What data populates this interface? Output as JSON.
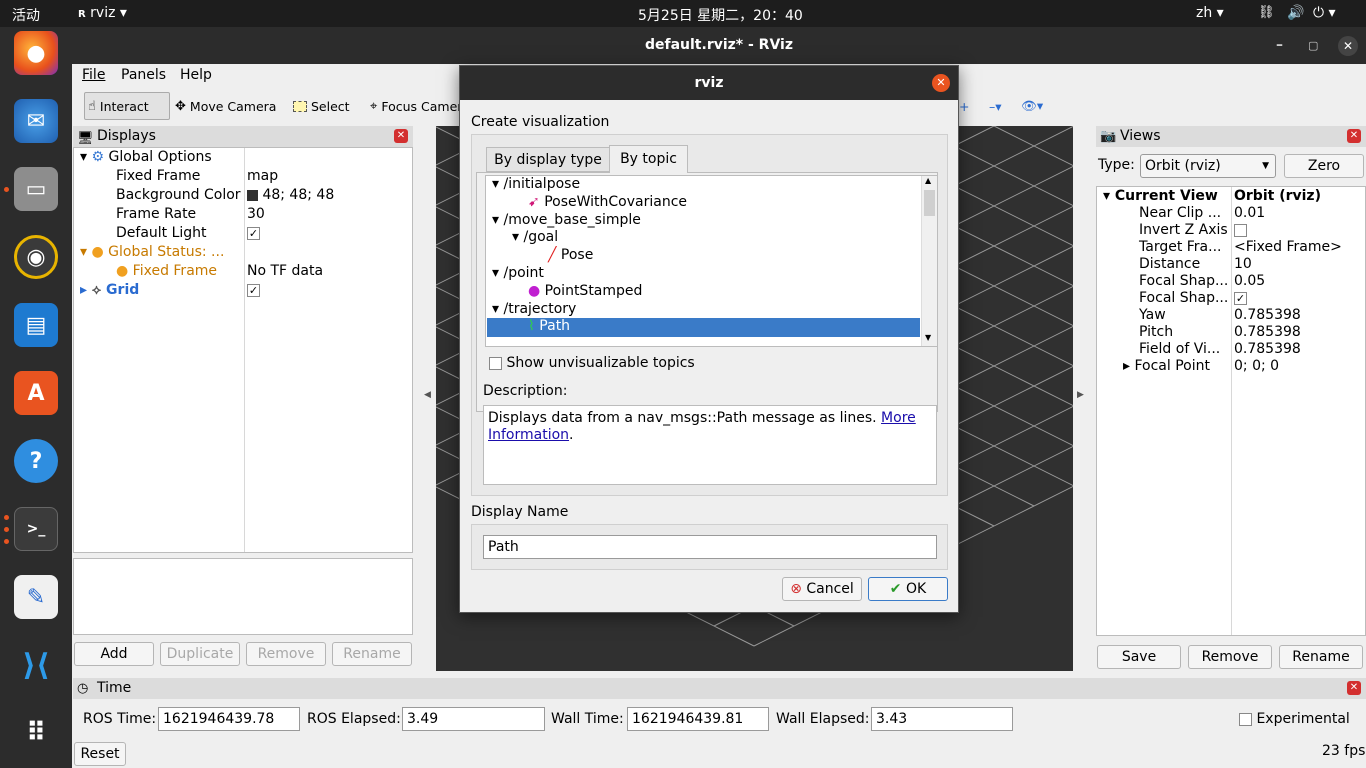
{
  "topbar": {
    "activities": "活动",
    "app": "rviz",
    "clock": "5月25日 星期二，20：40",
    "lang": "zh"
  },
  "window": {
    "title": "default.rviz* - RViz"
  },
  "menu": {
    "file": "File",
    "panels": "Panels",
    "help": "Help"
  },
  "toolbar": {
    "interact": "Interact",
    "move_camera": "Move Camera",
    "select": "Select",
    "focus_camera": "Focus Camera"
  },
  "displays": {
    "title": "Displays",
    "global_options": "Global Options",
    "fixed_frame_label": "Fixed Frame",
    "fixed_frame_value": "map",
    "bg_label": "Background Color",
    "bg_value": "48; 48; 48",
    "frame_rate_label": "Frame Rate",
    "frame_rate_value": "30",
    "default_light_label": "Default Light",
    "global_status": "Global Status: ...",
    "status_fixed_frame": "Fixed Frame",
    "status_fixed_frame_value": "No TF data",
    "grid": "Grid",
    "buttons": {
      "add": "Add",
      "duplicate": "Duplicate",
      "remove": "Remove",
      "rename": "Rename"
    }
  },
  "views": {
    "title": "Views",
    "type_label": "Type:",
    "type_value": "Orbit (rviz)",
    "zero": "Zero",
    "current_view": "Current View",
    "current_view_value": "Orbit (rviz)",
    "rows": [
      {
        "label": "Near Clip ...",
        "value": "0.01"
      },
      {
        "label": "Invert Z Axis",
        "value": ""
      },
      {
        "label": "Target Fra...",
        "value": "<Fixed Frame>"
      },
      {
        "label": "Distance",
        "value": "10"
      },
      {
        "label": "Focal Shap...",
        "value": "0.05"
      },
      {
        "label": "Focal Shap...",
        "value": ""
      },
      {
        "label": "Yaw",
        "value": "0.785398"
      },
      {
        "label": "Pitch",
        "value": "0.785398"
      },
      {
        "label": "Field of Vi...",
        "value": "0.785398"
      },
      {
        "label": "Focal Point",
        "value": "0; 0; 0"
      }
    ],
    "buttons": {
      "save": "Save",
      "remove": "Remove",
      "rename": "Rename"
    }
  },
  "time": {
    "title": "Time",
    "ros_time_label": "ROS Time:",
    "ros_time": "1621946439.78",
    "ros_elapsed_label": "ROS Elapsed:",
    "ros_elapsed": "3.49",
    "wall_time_label": "Wall Time:",
    "wall_time": "1621946439.81",
    "wall_elapsed_label": "Wall Elapsed:",
    "wall_elapsed": "3.43",
    "experimental": "Experimental",
    "reset": "Reset",
    "fps": "23 fps"
  },
  "dialog": {
    "title": "rviz",
    "create_label": "Create visualization",
    "tab_display_type": "By display type",
    "tab_by_topic": "By topic",
    "topics": {
      "initialpose": "/initialpose",
      "pose_cov": "PoseWithCovariance",
      "move_base_simple": "/move_base_simple",
      "goal": "/goal",
      "pose": "Pose",
      "point": "/point",
      "point_stamped": "PointStamped",
      "trajectory": "/trajectory",
      "path": "Path"
    },
    "show_unvisualizable": "Show unvisualizable topics",
    "description_label": "Description:",
    "description_text": "Displays data from a nav_msgs::Path message as lines. ",
    "more_info_1": "More",
    "more_info_2": "Information",
    "description_end": ".",
    "display_name_label": "Display Name",
    "display_name_value": "Path",
    "cancel": "Cancel",
    "ok": "OK"
  },
  "colors": {
    "selection": "#3a7bc8",
    "accent": "#e95420",
    "grid_line": "#9a9a9a"
  }
}
